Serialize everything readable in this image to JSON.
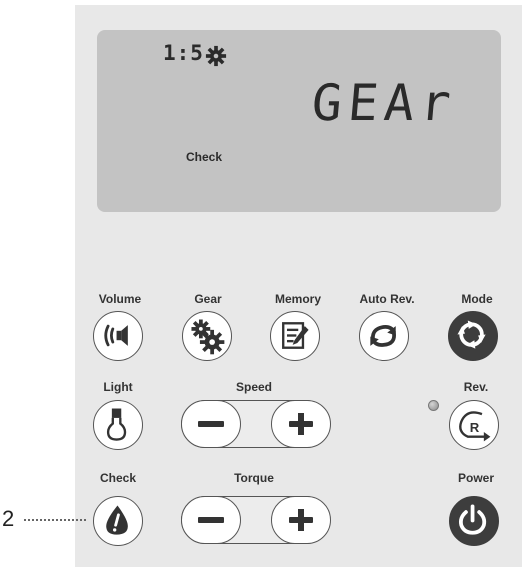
{
  "display": {
    "ratio": "1:5",
    "ratio_icon": "gear-icon",
    "main_text": "GEAr",
    "check_label": "Check"
  },
  "buttons": {
    "volume": {
      "label": "Volume",
      "icon": "speaker-icon"
    },
    "gear": {
      "label": "Gear",
      "icon": "gears-icon"
    },
    "memory": {
      "label": "Memory",
      "icon": "memory-edit-icon"
    },
    "auto_rev": {
      "label": "Auto Rev.",
      "icon": "auto-reverse-icon"
    },
    "mode": {
      "label": "Mode",
      "icon": "mode-icon"
    },
    "light": {
      "label": "Light",
      "icon": "light-bulb-icon"
    },
    "speed": {
      "label": "Speed",
      "minus": "minus-icon",
      "plus": "plus-icon"
    },
    "rev": {
      "label": "Rev.",
      "icon": "reverse-icon"
    },
    "check": {
      "label": "Check",
      "icon": "warning-drop-icon"
    },
    "torque": {
      "label": "Torque",
      "minus": "minus-icon",
      "plus": "plus-icon"
    },
    "power": {
      "label": "Power",
      "icon": "power-icon"
    }
  },
  "callout": {
    "number": "2"
  },
  "colors": {
    "panel": "#e8e8e8",
    "lcd": "#c3c3c3",
    "dark": "#3d3d3d"
  }
}
